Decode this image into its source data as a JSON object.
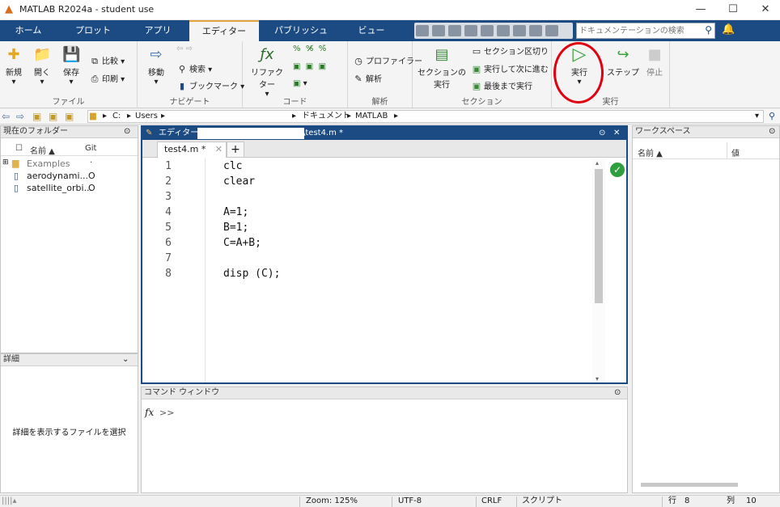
{
  "window": {
    "title": "MATLAB R2024a - student use"
  },
  "tabs": [
    "ホーム",
    "プロット",
    "アプリ",
    "エディター",
    "パブリッシュ",
    "ビュー"
  ],
  "search": {
    "placeholder": "ドキュメンテーションの検索"
  },
  "ribbon": {
    "file": {
      "new": "新規",
      "open": "開く",
      "save": "保存",
      "compare": "比較",
      "print": "印刷",
      "label": "ファイル"
    },
    "navigate": {
      "goto": "移動",
      "find": "検索",
      "bookmark": "ブックマーク",
      "label": "ナビゲート"
    },
    "code": {
      "refactor": "リファクター",
      "label": "コード"
    },
    "analyze": {
      "profiler": "プロファイラー",
      "analyze": "解析",
      "label": "解析"
    },
    "section": {
      "run_section": "セクションの",
      "run_section2": "実行",
      "section_break": "セクション区切り",
      "run_advance": "実行して次に進む",
      "run_to_end": "最後まで実行",
      "label": "セクション"
    },
    "run": {
      "run": "実行",
      "step": "ステップ",
      "stop": "停止",
      "label": "実行"
    }
  },
  "address": {
    "segments": [
      "C:",
      "Users",
      "ドキュメント",
      "MATLAB"
    ]
  },
  "current_folder": {
    "title": "現在のフォルダー",
    "col_name": "名前 ▲",
    "col_git": "Git",
    "col_git_top": "·",
    "items": [
      {
        "name": "Examples",
        "git": ""
      },
      {
        "name": "aerodynami...",
        "git": "O"
      },
      {
        "name": "satellite_orbi...",
        "git": "O"
      }
    ]
  },
  "details": {
    "title": "詳細",
    "message": "詳細を表示するファイルを選択"
  },
  "editor": {
    "header": "エディター -",
    "header_file": "\\test4.m *",
    "tab": "test4.m *",
    "lines": [
      "clc",
      "clear",
      "",
      "A=1;",
      "B=1;",
      "C=A+B;",
      "",
      "disp (C);"
    ],
    "line_numbers": [
      "1",
      "2",
      "3",
      "4",
      "5",
      "6",
      "7",
      "8"
    ]
  },
  "command_window": {
    "title": "コマンド ウィンドウ",
    "prompt": ">>",
    "fx": "fx"
  },
  "workspace": {
    "title": "ワークスペース",
    "col_name": "名前 ▲",
    "col_value": "値"
  },
  "status": {
    "zoom": "Zoom: 125%",
    "encoding": "UTF-8",
    "eol": "CRLF",
    "type": "スクリプト",
    "row_label": "行",
    "row": "8",
    "col_label": "列",
    "col": "10"
  }
}
